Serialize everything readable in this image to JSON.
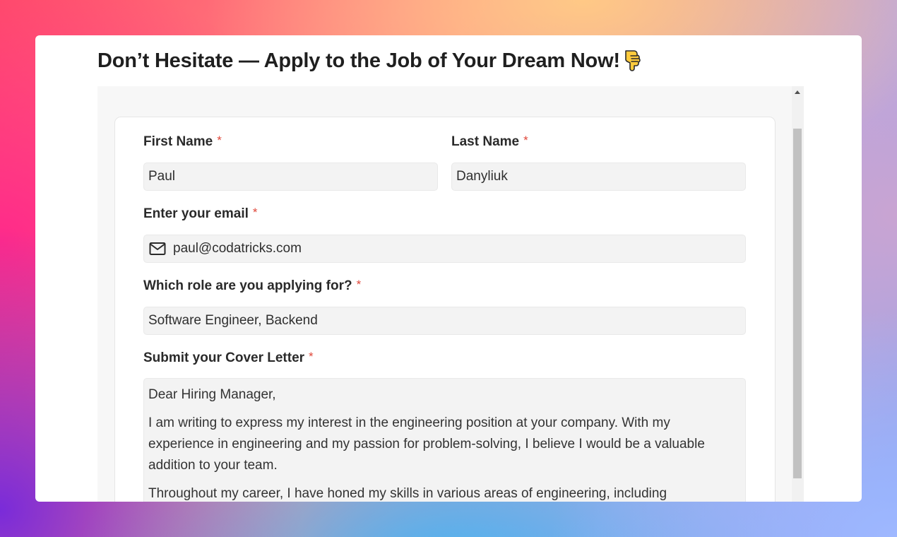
{
  "page": {
    "title": "Don’t Hesitate — Apply to the Job of Your Dream Now!",
    "title_emoji": "pointing-down-hand-icon"
  },
  "form": {
    "required_marker": "*",
    "first_name": {
      "label": "First Name",
      "value": "Paul"
    },
    "last_name": {
      "label": "Last Name",
      "value": "Danyliuk"
    },
    "email": {
      "label": "Enter your email",
      "value": "paul@codatricks.com",
      "icon": "mail-icon"
    },
    "role": {
      "label": "Which role are you applying for?",
      "value": "Software Engineer, Backend"
    },
    "cover_letter": {
      "label": "Submit your Cover Letter",
      "paragraphs": [
        "Dear Hiring Manager,",
        "I am writing to express my interest in the engineering position at your company. With my experience in engineering and my passion for problem-solving, I believe I would be a valuable addition to your team.",
        "Throughout my career, I have honed my skills in various areas of engineering, including"
      ]
    }
  },
  "colors": {
    "required": "#e0473a",
    "input_bg": "#f3f3f3"
  }
}
